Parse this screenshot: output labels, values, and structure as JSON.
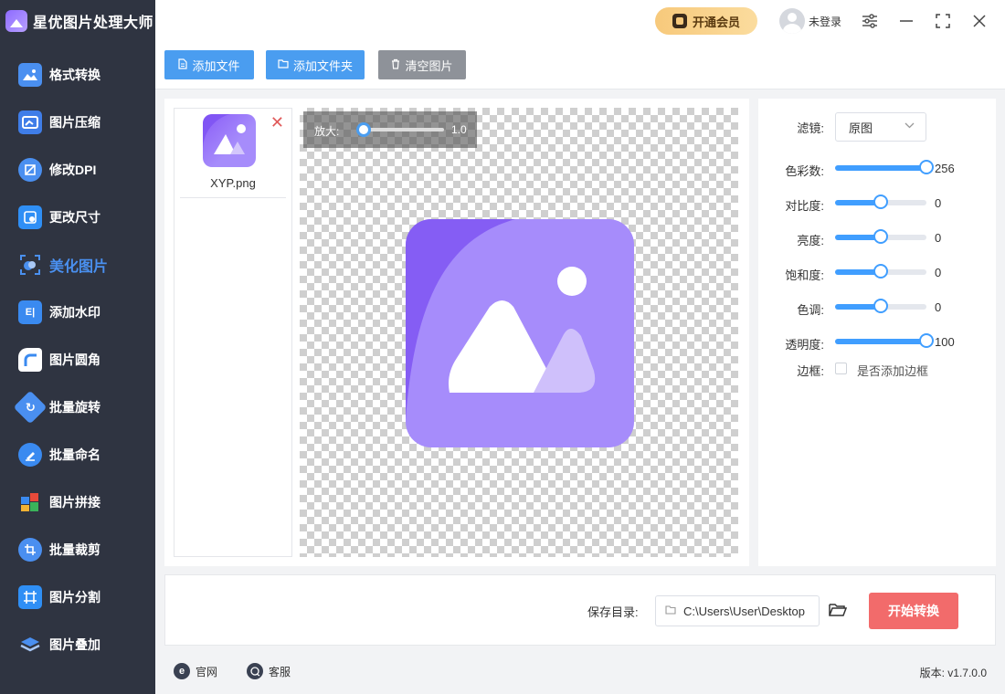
{
  "app": {
    "title": "星优图片处理大师"
  },
  "sidebar": {
    "items": [
      {
        "label": "格式转换",
        "icon": "format-convert-icon",
        "color": "#4a8ff0",
        "active": false
      },
      {
        "label": "图片压缩",
        "icon": "compress-icon",
        "color": "#3f7de8",
        "active": false
      },
      {
        "label": "修改DPI",
        "icon": "dpi-icon",
        "color": "#4a8ff0",
        "active": false
      },
      {
        "label": "更改尺寸",
        "icon": "resize-icon",
        "color": "#2f8ff5",
        "active": false
      },
      {
        "label": "美化图片",
        "icon": "beautify-icon",
        "color": "#4a90f0",
        "active": true
      },
      {
        "label": "添加水印",
        "icon": "watermark-icon",
        "color": "#3a8af0",
        "active": false
      },
      {
        "label": "图片圆角",
        "icon": "rounded-corner-icon",
        "color": "#3a8af0",
        "active": false
      },
      {
        "label": "批量旋转",
        "icon": "rotate-icon",
        "color": "#4a8ff0",
        "active": false
      },
      {
        "label": "批量命名",
        "icon": "rename-icon",
        "color": "#3a8af0",
        "active": false
      },
      {
        "label": "图片拼接",
        "icon": "stitch-icon",
        "color": "#e8a23a",
        "active": false
      },
      {
        "label": "批量裁剪",
        "icon": "crop-icon",
        "color": "#4a8ff0",
        "active": false
      },
      {
        "label": "图片分割",
        "icon": "split-icon",
        "color": "#2f8ff5",
        "active": false
      },
      {
        "label": "图片叠加",
        "icon": "overlay-icon",
        "color": "#4a8ff0",
        "active": false
      }
    ]
  },
  "topbar": {
    "vip_label": "开通会员",
    "user_label": "未登录"
  },
  "toolbar": {
    "add_file": "添加文件",
    "add_folder": "添加文件夹",
    "clear": "清空图片"
  },
  "files": [
    {
      "name": "XYP.png"
    }
  ],
  "preview": {
    "zoom_label": "放大:",
    "zoom_value": "1.0",
    "zoom_fraction": 0.0
  },
  "settings": {
    "filter_label": "滤镜:",
    "filter_value": "原图",
    "sliders": [
      {
        "label": "色彩数:",
        "value": "256",
        "fraction": 1.0
      },
      {
        "label": "对比度:",
        "value": "0",
        "fraction": 0.5
      },
      {
        "label": "亮度:",
        "value": "0",
        "fraction": 0.5
      },
      {
        "label": "饱和度:",
        "value": "0",
        "fraction": 0.5
      },
      {
        "label": "色调:",
        "value": "0",
        "fraction": 0.5
      },
      {
        "label": "透明度:",
        "value": "100",
        "fraction": 1.0
      }
    ],
    "border_label": "边框:",
    "border_checkbox_label": "是否添加边框",
    "border_checked": false
  },
  "output": {
    "save_label": "保存目录:",
    "path": "C:\\Users\\User\\Desktop",
    "start_label": "开始转换"
  },
  "footer": {
    "website": "官网",
    "support": "客服",
    "version": "版本: v1.7.0.0"
  },
  "colors": {
    "sidebar_bg": "#2f3441",
    "primary": "#409eff",
    "toolbar_blue": "#4a9df0",
    "clear_gray": "#8e9299",
    "start_red": "#f26b6b",
    "image_purple": "#a68cfb"
  }
}
